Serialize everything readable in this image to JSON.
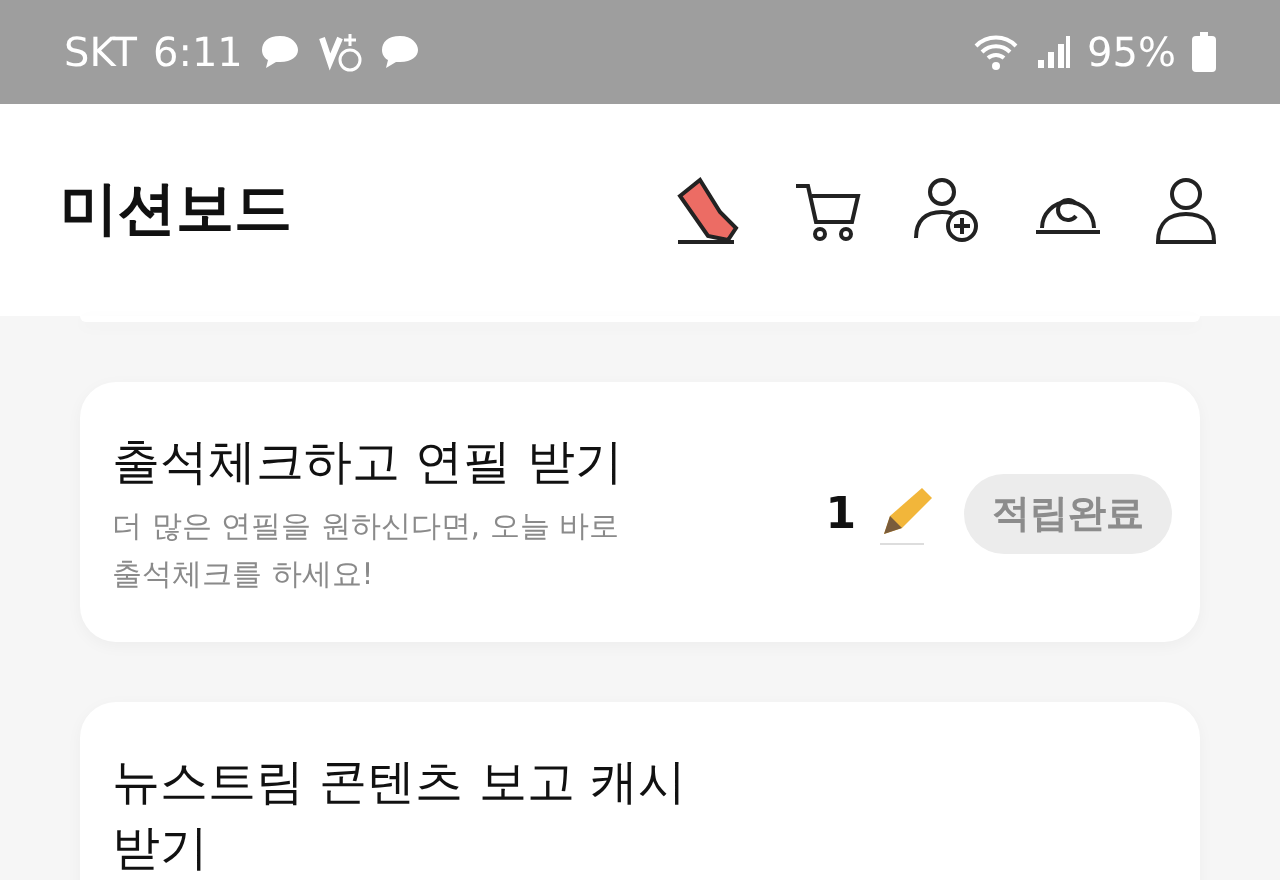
{
  "status_bar": {
    "carrier": "SKT",
    "time": "6:11",
    "battery": "95%"
  },
  "header": {
    "title": "미션보드"
  },
  "missions": [
    {
      "title": "출석체크하고 연필 받기",
      "description": "더 많은 연필을 원하신다면, 오늘 바로 출석체크를 하세요!",
      "reward": "1",
      "button": "적립완료",
      "completed": true
    },
    {
      "title": "뉴스트림 콘텐츠 보고 캐시 받기"
    }
  ]
}
